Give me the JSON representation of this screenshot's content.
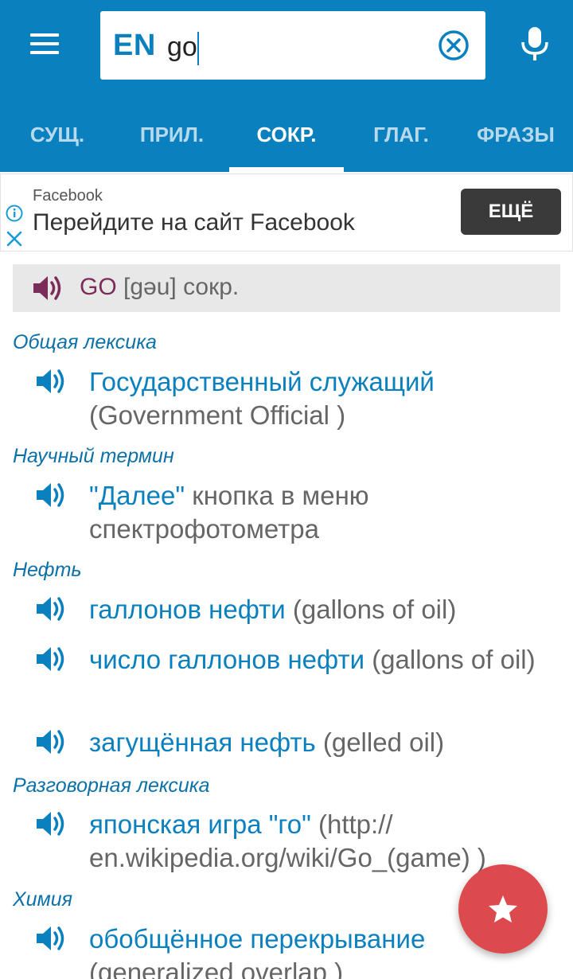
{
  "search": {
    "lang": "EN",
    "query": "go"
  },
  "tabs": [
    {
      "label": "СУЩ."
    },
    {
      "label": "ПРИЛ."
    },
    {
      "label": "СОКР."
    },
    {
      "label": "ГЛАГ."
    },
    {
      "label": "ФРАЗЫ"
    }
  ],
  "active_tab": "СОКР.",
  "ad": {
    "source": "Facebook",
    "text": "Перейдите на сайт Facebook",
    "button": "ЕЩЁ"
  },
  "headword": {
    "word": "GO",
    "transcription": "[ɡəu]",
    "pos": "сокр."
  },
  "sections": [
    {
      "category": "Общая лексика",
      "entries": [
        {
          "term": "Государственный служащий",
          "rest": "(Government Official )"
        }
      ]
    },
    {
      "category": "Научный термин",
      "entries": [
        {
          "term": "\"Далее\"",
          "rest": "кнопка в меню спектрофотометра"
        }
      ]
    },
    {
      "category": "Нефть",
      "entries": [
        {
          "term": "галлонов нефти",
          "rest": "(gallons of oil)"
        },
        {
          "term": "число галлонов нефти",
          "rest": "(gallons of oil)"
        },
        {
          "term": "загущённая нефть",
          "rest": "(gelled oil)"
        }
      ]
    },
    {
      "category": "Разговорная лексика",
      "entries": [
        {
          "term": "японская игра \"го\"",
          "rest": "(http:// en.wikipedia.org/wiki/Go_(game) )"
        }
      ]
    },
    {
      "category": "Химия",
      "entries": [
        {
          "term": "обобщённое перекрывание",
          "rest": "(generalized overlap )"
        }
      ]
    }
  ],
  "colors": {
    "appbar": "#0b80bf",
    "link": "#0b80bf",
    "category": "#0b71a8",
    "headword": "#7b2d5a",
    "fab": "#dd4a4e"
  },
  "icons": {
    "menu": "menu-icon",
    "clear": "clear-icon",
    "mic": "mic-icon",
    "speaker": "speaker-icon",
    "fab": "star-icon",
    "ad_info": "info-icon",
    "ad_close": "close-icon"
  }
}
